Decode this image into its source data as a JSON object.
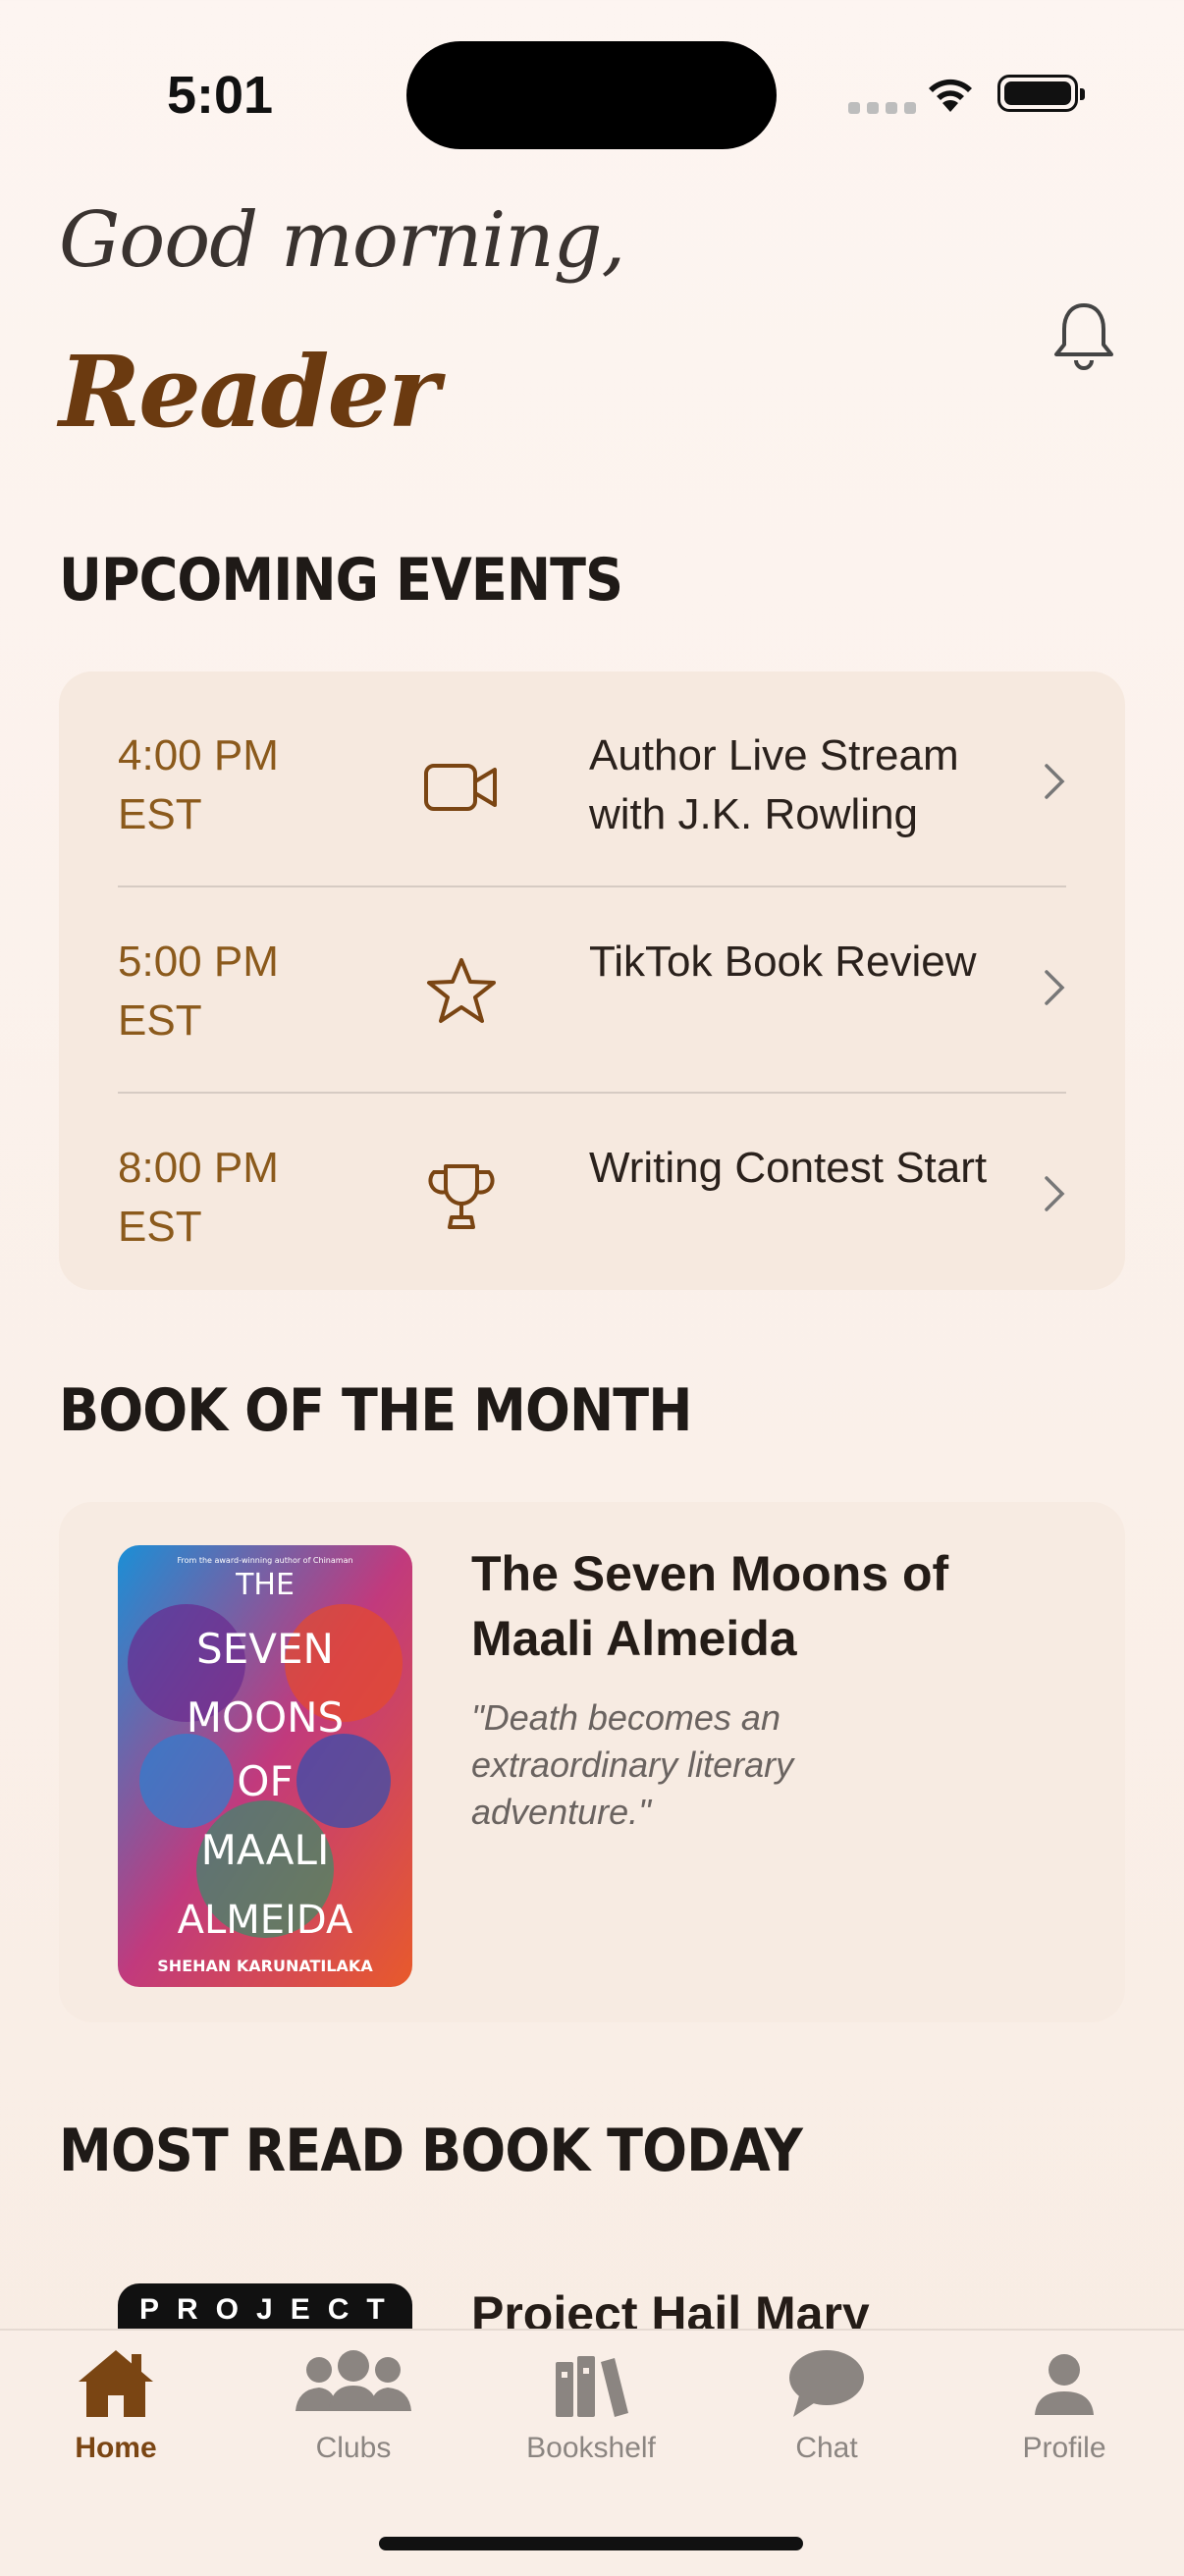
{
  "status": {
    "time": "5:01"
  },
  "header": {
    "greeting": "Good morning,",
    "name": "Reader"
  },
  "sections": {
    "upcoming": "UPCOMING EVENTS",
    "book_of_month": "BOOK OF THE MONTH",
    "most_read": "MOST READ BOOK TODAY"
  },
  "events": [
    {
      "time": "4:00 PM EST",
      "title": "Author Live Stream with J.K. Rowling",
      "icon": "video-camera-icon"
    },
    {
      "time": "5:00 PM EST",
      "title": "TikTok Book Review",
      "icon": "star-icon"
    },
    {
      "time": "8:00 PM EST",
      "title": "Writing Contest Start",
      "icon": "trophy-icon"
    }
  ],
  "book_of_month": {
    "title": "The Seven Moons of Maali Almeida",
    "quote": "\"Death becomes an extraordinary literary adventure.\"",
    "cover": {
      "tagline": "From the award-winning author of Chinaman",
      "lines": [
        "THE",
        "SEVEN",
        "MOONS",
        "OF",
        "MAALI",
        "ALMEIDA"
      ],
      "author": "SHEHAN KARUNATILAKA"
    }
  },
  "most_read": {
    "title": "Project Hail Mary",
    "cover_text": "PROJECT"
  },
  "tabs": [
    {
      "label": "Home",
      "icon": "house-icon",
      "active": true
    },
    {
      "label": "Clubs",
      "icon": "people-icon",
      "active": false
    },
    {
      "label": "Bookshelf",
      "icon": "books-icon",
      "active": false
    },
    {
      "label": "Chat",
      "icon": "chat-bubble-icon",
      "active": false
    },
    {
      "label": "Profile",
      "icon": "person-icon",
      "active": false
    }
  ],
  "colors": {
    "accent": "#7a4513",
    "event_time": "#8b5a1c",
    "card": "#f6e9df"
  }
}
